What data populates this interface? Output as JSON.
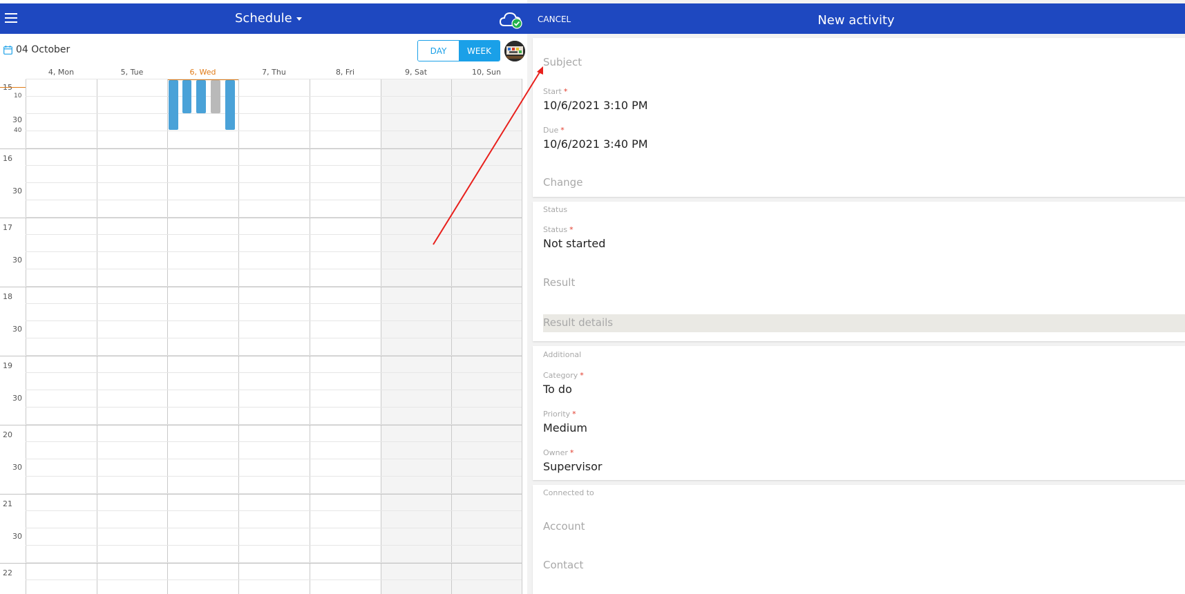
{
  "left_header": {
    "title": "Schedule"
  },
  "toolbar": {
    "date": "04 October",
    "day_label": "DAY",
    "week_label": "WEEK"
  },
  "week_days": [
    "4, Mon",
    "5, Tue",
    "6, Wed",
    "7, Thu",
    "8, Fri",
    "9, Sat",
    "10, Sun"
  ],
  "today_index": 2,
  "time_labels": {
    "hours": [
      "15",
      "16",
      "17",
      "18",
      "19",
      "20",
      "21",
      "22"
    ],
    "half": "30",
    "minor_10": "10",
    "minor_40": "40"
  },
  "right_header": {
    "cancel": "CANCEL",
    "title": "New activity"
  },
  "form": {
    "subject_placeholder": "Subject",
    "start_label": "Start",
    "start_value": "10/6/2021 3:10 PM",
    "due_label": "Due",
    "due_value": "10/6/2021 3:40 PM",
    "change_label": "Change",
    "status_section": "Status",
    "status_label": "Status",
    "status_value": "Not started",
    "result_label": "Result",
    "result_details_label": "Result details",
    "additional_section": "Additional",
    "category_label": "Category",
    "category_value": "To do",
    "priority_label": "Priority",
    "priority_value": "Medium",
    "owner_label": "Owner",
    "owner_value": "Supervisor",
    "connected_section": "Connected to",
    "account_label": "Account",
    "contact_label": "Contact",
    "required_mark": "*"
  },
  "colors": {
    "header": "#1e48c0",
    "accent": "#1aa0e8",
    "today": "#e07a16",
    "event": "#4aa2d8",
    "event_grey": "#b9b9b9",
    "annotation": "#e8201c"
  },
  "icons": [
    "menu-icon",
    "caret-down-icon",
    "cloud-sync-icon",
    "calendar-icon",
    "avatar"
  ]
}
